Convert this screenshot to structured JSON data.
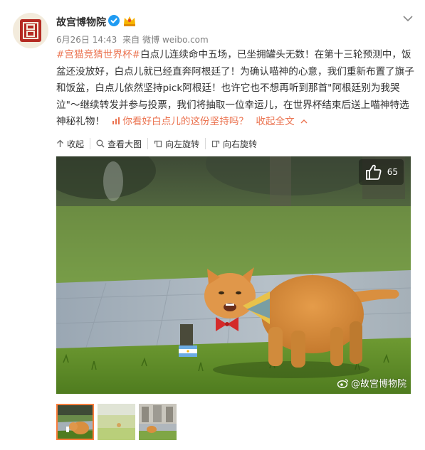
{
  "post": {
    "username": "故宫博物院",
    "date": "6月26日 14:43",
    "source_prefix": "来自",
    "source": "微博 weibo.com",
    "hashtag1": "#宫猫竞猜世界杯#",
    "body1": "白点儿连续命中五场，已坐拥罐头无数！在第十三轮预测中，饭盆还没放好，白点儿就已经直奔阿根廷了！为确认喵神的心意，我们重新布置了旗子和饭盆，白点儿依然坚持pick阿根廷！也许它也不想再听到那首\"阿根廷别为我哭泣\"～继续转发并参与投票，我们将抽取一位幸运儿，在世界杯结束后送上喵神特选神秘礼物！",
    "vote_link": "你看好白点儿的这份坚持吗？",
    "collapse_link": "收起全文"
  },
  "toolbar": {
    "collapse": "收起",
    "view_large": "查看大图",
    "rotate_left": "向左旋转",
    "rotate_right": "向右旋转"
  },
  "photo": {
    "like_count": "65",
    "watermark": "@故宫博物院"
  },
  "colors": {
    "link": "#eb7350",
    "verified": "#1f9bf2",
    "thumb_active_border": "#fa7d3c"
  }
}
